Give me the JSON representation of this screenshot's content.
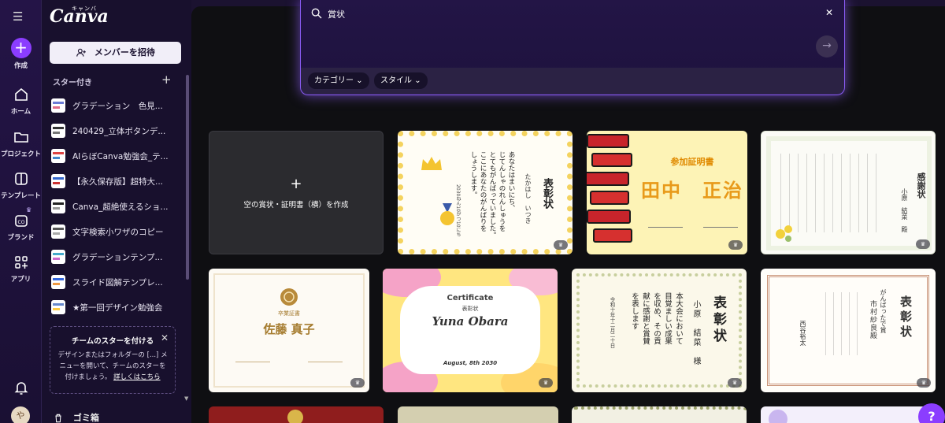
{
  "rail": {
    "create_label": "作成",
    "items": [
      {
        "label": "ホーム",
        "icon": "home-icon"
      },
      {
        "label": "プロジェクト",
        "icon": "folder-icon"
      },
      {
        "label": "テンプレート",
        "icon": "template-icon"
      },
      {
        "label": "ブランド",
        "icon": "brand-icon"
      },
      {
        "label": "アプリ",
        "icon": "apps-icon"
      }
    ],
    "avatar_initial": "や"
  },
  "panel": {
    "logo": "Canva",
    "logo_kana": "キャンバ",
    "invite_label": "メンバーを招待",
    "starred_title": "スター付き",
    "starred": [
      "グラデーション　色見...",
      "240429_立体ボタンデ...",
      "AIらぼCanva勉強会_テ...",
      "【永久保存版】超特大...",
      "Canva_超絶使えるショ...",
      "文字検索小ワザのコピー",
      "グラデーションテンプ...",
      "スライド図解テンプレ...",
      "★第一回デザイン勉強会"
    ],
    "tip": {
      "title": "チームのスターを付ける",
      "body": "デザインまたはフォルダーの [...] メニューを開いて、チームのスターを付けましょう。",
      "link": "詳しくはこちら"
    },
    "trash_label": "ゴミ箱"
  },
  "search": {
    "query": "賞状",
    "filters": [
      "カテゴリー",
      "スタイル"
    ]
  },
  "grid": {
    "create_blank_label": "空の賞状・証明書（横）を作成",
    "cards": [
      {
        "title": "表彰状",
        "name": "たかはし　いつき",
        "body_lines": [
          "あなたはまいにち、",
          "じてんしゃのれんしゅうを",
          "とてもがんばっていました。",
          "ここにあなたのがんばりを",
          "しょうします。"
        ],
        "date": "2030ねん10がつ10にち"
      },
      {
        "title": "参加証明書",
        "name": "田中　正治"
      },
      {
        "title": "感謝状",
        "name": "小原　結菜　殿"
      },
      {
        "title": "卒業証書",
        "name": "佐藤 真子"
      },
      {
        "title": "Certificate",
        "subtitle": "表彰状",
        "name": "Yuna Obara",
        "date": "August, 8th 2030"
      },
      {
        "title": "表彰状",
        "name": "小原　結菜　様",
        "body_lines": [
          "本大会において",
          "目覚ましい成果",
          "を収め、その貢",
          "献に感謝と賞賛",
          "を表します"
        ],
        "date": "令和十年十二月二十日"
      },
      {
        "title": "表彰状",
        "subtitle": "がんばったで賞",
        "name": "市村紗良殿",
        "sender": "西谷裕太"
      }
    ]
  }
}
